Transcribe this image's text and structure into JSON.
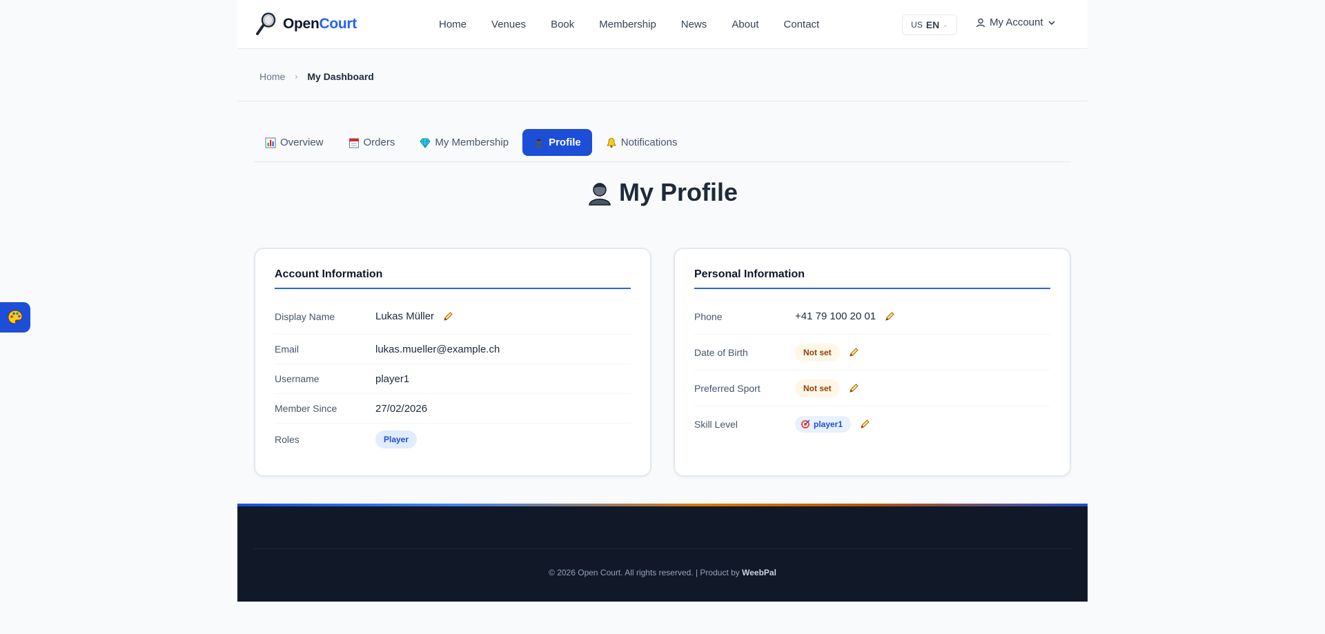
{
  "header": {
    "logo_open": "Open",
    "logo_court": "Court",
    "nav": [
      "Home",
      "Venues",
      "Book",
      "Membership",
      "News",
      "About",
      "Contact"
    ],
    "lang_flag": "US",
    "lang_code": "EN",
    "account_label": "My Account"
  },
  "breadcrumb": {
    "home": "Home",
    "current": "My Dashboard"
  },
  "tabs": [
    {
      "label": "Overview",
      "icon": "bar-chart-icon",
      "active": false
    },
    {
      "label": "Orders",
      "icon": "calendar-icon",
      "active": false
    },
    {
      "label": "My Membership",
      "icon": "gem-icon",
      "active": false
    },
    {
      "label": "Profile",
      "icon": "person-icon",
      "active": true
    },
    {
      "label": "Notifications",
      "icon": "bell-icon",
      "active": false
    }
  ],
  "page_title": "My Profile",
  "account_info": {
    "title": "Account Information",
    "rows": [
      {
        "label": "Display Name",
        "value": "Lukas Müller",
        "editable": true
      },
      {
        "label": "Email",
        "value": "lukas.mueller@example.ch",
        "editable": false
      },
      {
        "label": "Username",
        "value": "player1",
        "editable": false
      },
      {
        "label": "Member Since",
        "value": "27/02/2026",
        "editable": false
      },
      {
        "label": "Roles",
        "value": "Player",
        "editable": false
      }
    ]
  },
  "personal_info": {
    "title": "Personal Information",
    "rows": [
      {
        "label": "Phone",
        "value": "+41 79 100 20 01",
        "editable": true
      },
      {
        "label": "Date of Birth",
        "value": "Not set",
        "editable": true
      },
      {
        "label": "Preferred Sport",
        "value": "Not set",
        "editable": true
      },
      {
        "label": "Skill Level",
        "value": "player1",
        "editable": true
      }
    ]
  },
  "footer": {
    "copyright": "© 2026 Open Court. All rights reserved. | Product by",
    "brand": "WeebPal"
  },
  "colors": {
    "accent": "#1d4ed8",
    "logo_accent": "#2563eb",
    "footer_bg": "#111827",
    "not_set_bg": "#fff7e6"
  }
}
